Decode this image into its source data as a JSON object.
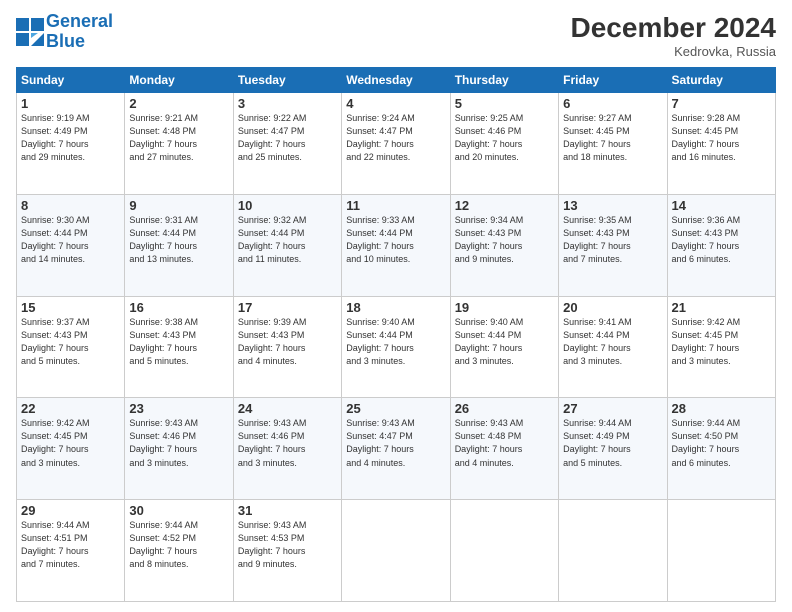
{
  "header": {
    "logo_line1": "General",
    "logo_line2": "Blue",
    "month_title": "December 2024",
    "location": "Kedrovka, Russia"
  },
  "weekdays": [
    "Sunday",
    "Monday",
    "Tuesday",
    "Wednesday",
    "Thursday",
    "Friday",
    "Saturday"
  ],
  "weeks": [
    [
      {
        "day": "1",
        "info": "Sunrise: 9:19 AM\nSunset: 4:49 PM\nDaylight: 7 hours\nand 29 minutes."
      },
      {
        "day": "2",
        "info": "Sunrise: 9:21 AM\nSunset: 4:48 PM\nDaylight: 7 hours\nand 27 minutes."
      },
      {
        "day": "3",
        "info": "Sunrise: 9:22 AM\nSunset: 4:47 PM\nDaylight: 7 hours\nand 25 minutes."
      },
      {
        "day": "4",
        "info": "Sunrise: 9:24 AM\nSunset: 4:47 PM\nDaylight: 7 hours\nand 22 minutes."
      },
      {
        "day": "5",
        "info": "Sunrise: 9:25 AM\nSunset: 4:46 PM\nDaylight: 7 hours\nand 20 minutes."
      },
      {
        "day": "6",
        "info": "Sunrise: 9:27 AM\nSunset: 4:45 PM\nDaylight: 7 hours\nand 18 minutes."
      },
      {
        "day": "7",
        "info": "Sunrise: 9:28 AM\nSunset: 4:45 PM\nDaylight: 7 hours\nand 16 minutes."
      }
    ],
    [
      {
        "day": "8",
        "info": "Sunrise: 9:30 AM\nSunset: 4:44 PM\nDaylight: 7 hours\nand 14 minutes."
      },
      {
        "day": "9",
        "info": "Sunrise: 9:31 AM\nSunset: 4:44 PM\nDaylight: 7 hours\nand 13 minutes."
      },
      {
        "day": "10",
        "info": "Sunrise: 9:32 AM\nSunset: 4:44 PM\nDaylight: 7 hours\nand 11 minutes."
      },
      {
        "day": "11",
        "info": "Sunrise: 9:33 AM\nSunset: 4:44 PM\nDaylight: 7 hours\nand 10 minutes."
      },
      {
        "day": "12",
        "info": "Sunrise: 9:34 AM\nSunset: 4:43 PM\nDaylight: 7 hours\nand 9 minutes."
      },
      {
        "day": "13",
        "info": "Sunrise: 9:35 AM\nSunset: 4:43 PM\nDaylight: 7 hours\nand 7 minutes."
      },
      {
        "day": "14",
        "info": "Sunrise: 9:36 AM\nSunset: 4:43 PM\nDaylight: 7 hours\nand 6 minutes."
      }
    ],
    [
      {
        "day": "15",
        "info": "Sunrise: 9:37 AM\nSunset: 4:43 PM\nDaylight: 7 hours\nand 5 minutes."
      },
      {
        "day": "16",
        "info": "Sunrise: 9:38 AM\nSunset: 4:43 PM\nDaylight: 7 hours\nand 5 minutes."
      },
      {
        "day": "17",
        "info": "Sunrise: 9:39 AM\nSunset: 4:43 PM\nDaylight: 7 hours\nand 4 minutes."
      },
      {
        "day": "18",
        "info": "Sunrise: 9:40 AM\nSunset: 4:44 PM\nDaylight: 7 hours\nand 3 minutes."
      },
      {
        "day": "19",
        "info": "Sunrise: 9:40 AM\nSunset: 4:44 PM\nDaylight: 7 hours\nand 3 minutes."
      },
      {
        "day": "20",
        "info": "Sunrise: 9:41 AM\nSunset: 4:44 PM\nDaylight: 7 hours\nand 3 minutes."
      },
      {
        "day": "21",
        "info": "Sunrise: 9:42 AM\nSunset: 4:45 PM\nDaylight: 7 hours\nand 3 minutes."
      }
    ],
    [
      {
        "day": "22",
        "info": "Sunrise: 9:42 AM\nSunset: 4:45 PM\nDaylight: 7 hours\nand 3 minutes."
      },
      {
        "day": "23",
        "info": "Sunrise: 9:43 AM\nSunset: 4:46 PM\nDaylight: 7 hours\nand 3 minutes."
      },
      {
        "day": "24",
        "info": "Sunrise: 9:43 AM\nSunset: 4:46 PM\nDaylight: 7 hours\nand 3 minutes."
      },
      {
        "day": "25",
        "info": "Sunrise: 9:43 AM\nSunset: 4:47 PM\nDaylight: 7 hours\nand 4 minutes."
      },
      {
        "day": "26",
        "info": "Sunrise: 9:43 AM\nSunset: 4:48 PM\nDaylight: 7 hours\nand 4 minutes."
      },
      {
        "day": "27",
        "info": "Sunrise: 9:44 AM\nSunset: 4:49 PM\nDaylight: 7 hours\nand 5 minutes."
      },
      {
        "day": "28",
        "info": "Sunrise: 9:44 AM\nSunset: 4:50 PM\nDaylight: 7 hours\nand 6 minutes."
      }
    ],
    [
      {
        "day": "29",
        "info": "Sunrise: 9:44 AM\nSunset: 4:51 PM\nDaylight: 7 hours\nand 7 minutes."
      },
      {
        "day": "30",
        "info": "Sunrise: 9:44 AM\nSunset: 4:52 PM\nDaylight: 7 hours\nand 8 minutes."
      },
      {
        "day": "31",
        "info": "Sunrise: 9:43 AM\nSunset: 4:53 PM\nDaylight: 7 hours\nand 9 minutes."
      },
      null,
      null,
      null,
      null
    ]
  ]
}
